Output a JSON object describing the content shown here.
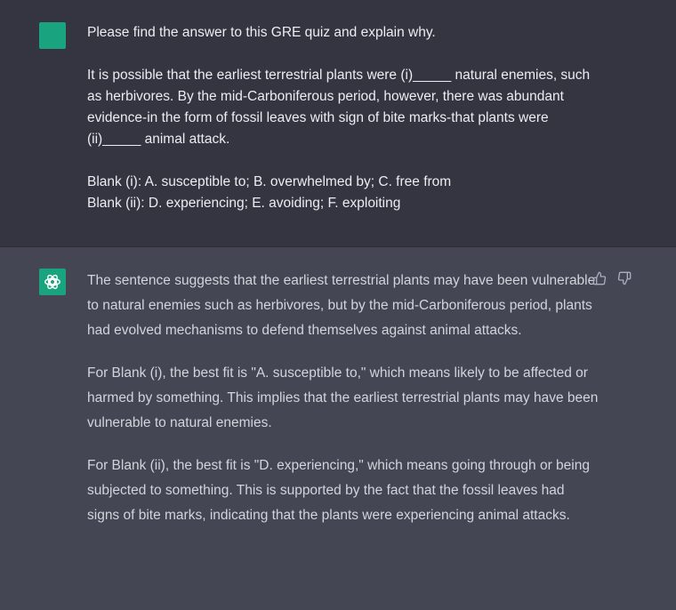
{
  "colors": {
    "user_bg": "#343541",
    "assistant_bg": "#444654",
    "user_avatar": "#19a37f",
    "assistant_avatar": "#19a37f"
  },
  "user_message": {
    "paragraphs": [
      "Please find the answer to this GRE quiz and explain why.",
      "It is possible that the earliest terrestrial plants were (i)_____ natural enemies, such as herbivores. By the mid-Carboniferous period, however, there was abundant evidence-in the form of fossil leaves with sign of bite marks-that plants were (ii)_____ animal attack.",
      "Blank (i): A. susceptible to; B. overwhelmed by; C. free from",
      "Blank (ii): D. experiencing; E. avoiding; F. exploiting"
    ]
  },
  "assistant_message": {
    "paragraphs": [
      "The sentence suggests that the earliest terrestrial plants may have been vulnerable to natural enemies such as herbivores, but by the mid-Carboniferous period, plants had evolved mechanisms to defend themselves against animal attacks.",
      "For Blank (i), the best fit is \"A. susceptible to,\" which means likely to be affected or harmed by something. This implies that the earliest terrestrial plants may have been vulnerable to natural enemies.",
      "For Blank (ii), the best fit is \"D. experiencing,\" which means going through or being subjected to something. This is supported by the fact that the fossil leaves had signs of bite marks, indicating that the plants were experiencing animal attacks."
    ],
    "icons": [
      "thumbs-up-icon",
      "thumbs-down-icon"
    ]
  }
}
